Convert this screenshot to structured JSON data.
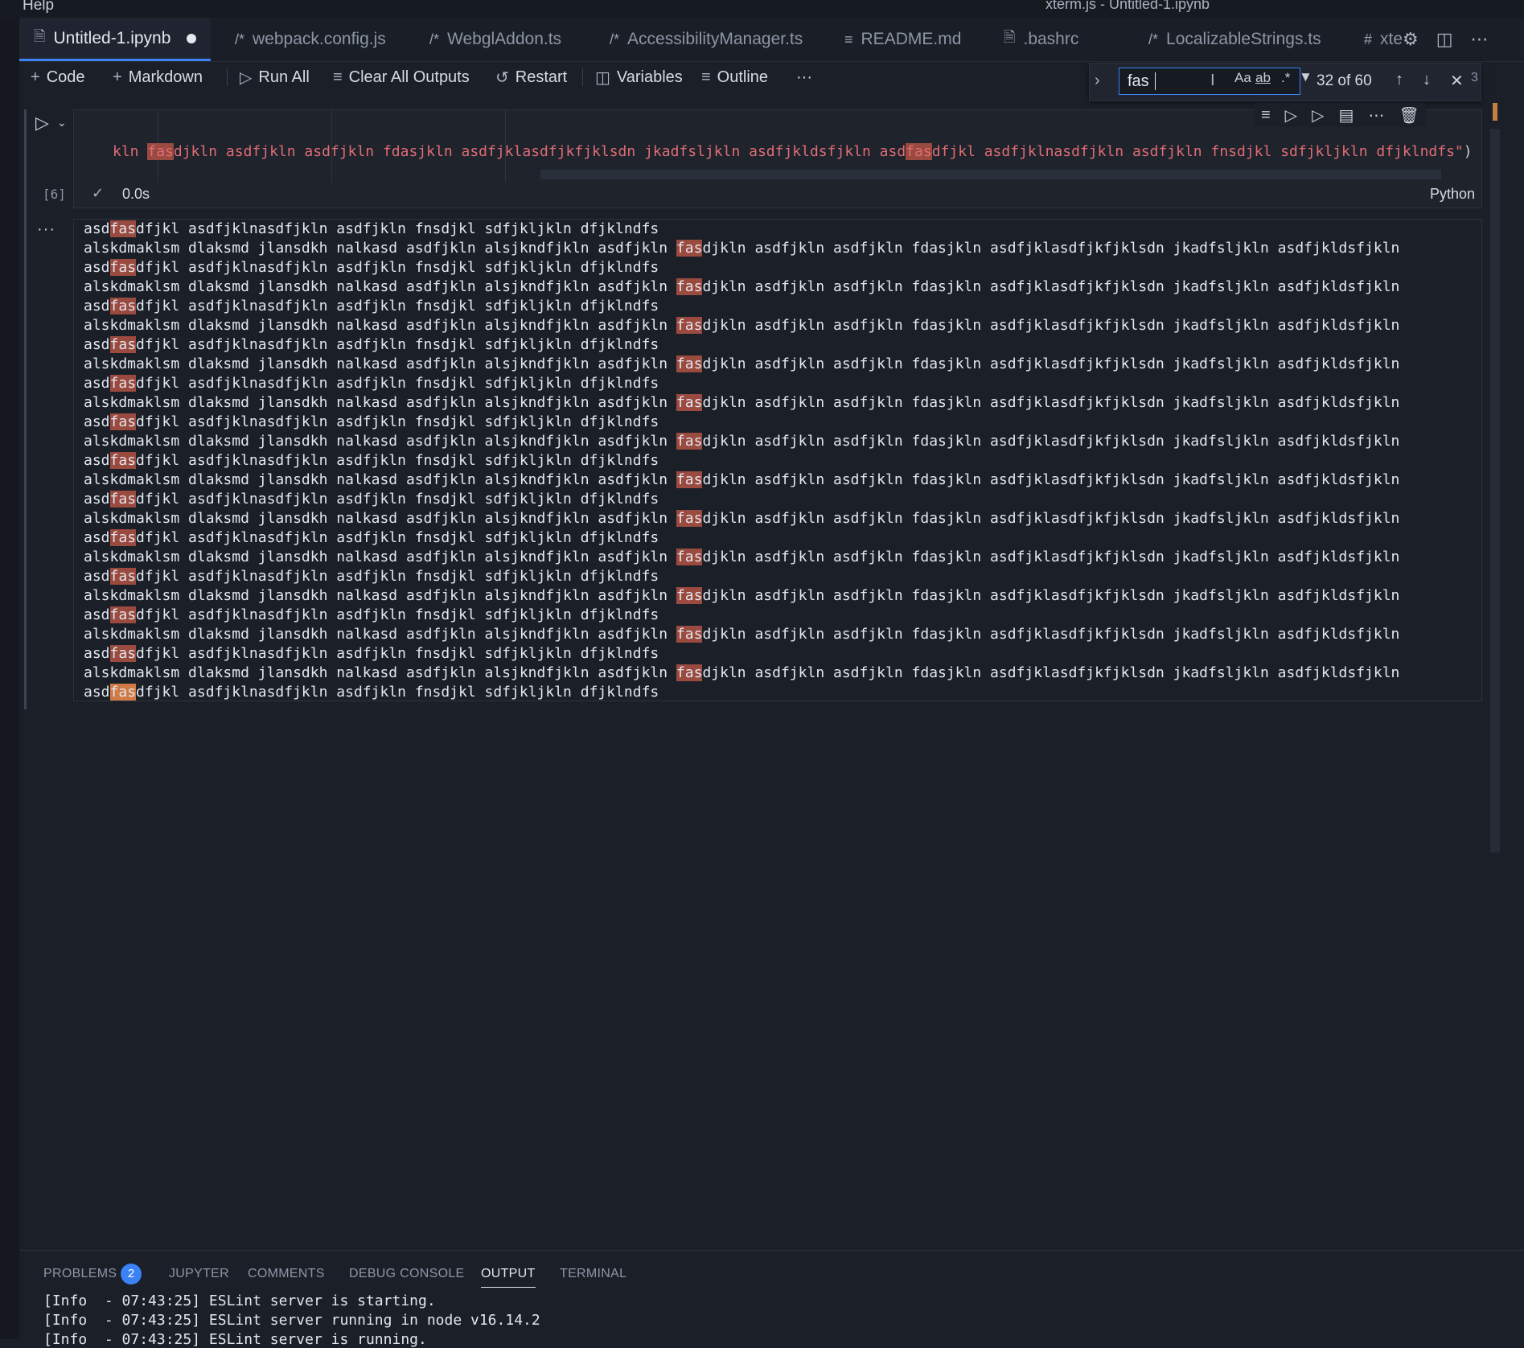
{
  "titlebar": {
    "menu_help": "Help",
    "window_title": "xterm.js - Untitled-1.ipynb"
  },
  "tabs": [
    {
      "label": "Untitled-1.ipynb",
      "icon": "notebook-icon",
      "active": true,
      "modified": true
    },
    {
      "label": "webpack.config.js",
      "icon": "js-icon"
    },
    {
      "label": "WebglAddon.ts",
      "icon": "ts-icon"
    },
    {
      "label": "AccessibilityManager.ts",
      "icon": "ts-icon"
    },
    {
      "label": "README.md",
      "icon": "markdown-icon"
    },
    {
      "label": ".bashrc",
      "icon": "file-icon"
    },
    {
      "label": "LocalizableStrings.ts",
      "icon": "ts-icon"
    },
    {
      "label": "xte",
      "icon": "hash-icon"
    }
  ],
  "toolbar": {
    "code": "Code",
    "markdown": "Markdown",
    "run_all": "Run All",
    "clear_outputs": "Clear All Outputs",
    "restart": "Restart",
    "variables": "Variables",
    "outline": "Outline",
    "more": "···"
  },
  "find": {
    "value": "fas",
    "match_case": "Aa",
    "whole_word": "ab",
    "regex": ".*",
    "count": "32 of 60",
    "overflow_digit": "3"
  },
  "cell": {
    "execution_count": "[6]",
    "time": "0.0s",
    "language": "Python",
    "code_segments": [
      {
        "t": "kln ",
        "h": false
      },
      {
        "t": "fas",
        "h": true
      },
      {
        "t": "djkln asdfjkln asdfjkln fdasjkln asdfjklasdfjkfjklsdn jkadfsljkln asdfjkldsfjkln asd",
        "h": false
      },
      {
        "t": "fas",
        "h": true
      },
      {
        "t": "dfjkl asdfjklnasdfjkln asdfjkln fnsdjkl sdfjkljkln dfjklndfs\"",
        "h": false
      }
    ],
    "code_end": ")"
  },
  "output": {
    "more": "···",
    "lines": [
      {
        "a": "asd",
        "b": "fas",
        "c": "dfjkl asdfjklnasdfjkln asdfjkln fnsdjkl sdfjkljkln dfjklndfs"
      },
      {
        "a": "alskdmaklsm dlaksmd jlansdkh nalkasd asdfjkln alsjkndfjkln asdfjkln ",
        "b": "fas",
        "c": "djkln asdfjkln asdfjkln fdasjkln asdfjklasdfjkfjklsdn jkadfsljkln asdfjkldsfjkln"
      },
      {
        "a": "asd",
        "b": "fas",
        "c": "dfjkl asdfjklnasdfjkln asdfjkln fnsdjkl sdfjkljkln dfjklndfs"
      },
      {
        "a": "alskdmaklsm dlaksmd jlansdkh nalkasd asdfjkln alsjkndfjkln asdfjkln ",
        "b": "fas",
        "c": "djkln asdfjkln asdfjkln fdasjkln asdfjklasdfjkfjklsdn jkadfsljkln asdfjkldsfjkln"
      },
      {
        "a": "asd",
        "b": "fas",
        "c": "dfjkl asdfjklnasdfjkln asdfjkln fnsdjkl sdfjkljkln dfjklndfs"
      },
      {
        "a": "alskdmaklsm dlaksmd jlansdkh nalkasd asdfjkln alsjkndfjkln asdfjkln ",
        "b": "fas",
        "c": "djkln asdfjkln asdfjkln fdasjkln asdfjklasdfjkfjklsdn jkadfsljkln asdfjkldsfjkln"
      },
      {
        "a": "asd",
        "b": "fas",
        "c": "dfjkl asdfjklnasdfjkln asdfjkln fnsdjkl sdfjkljkln dfjklndfs"
      },
      {
        "a": "alskdmaklsm dlaksmd jlansdkh nalkasd asdfjkln alsjkndfjkln asdfjkln ",
        "b": "fas",
        "c": "djkln asdfjkln asdfjkln fdasjkln asdfjklasdfjkfjklsdn jkadfsljkln asdfjkldsfjkln"
      },
      {
        "a": "asd",
        "b": "fas",
        "c": "dfjkl asdfjklnasdfjkln asdfjkln fnsdjkl sdfjkljkln dfjklndfs"
      },
      {
        "a": "alskdmaklsm dlaksmd jlansdkh nalkasd asdfjkln alsjkndfjkln asdfjkln ",
        "b": "fas",
        "c": "djkln asdfjkln asdfjkln fdasjkln asdfjklasdfjkfjklsdn jkadfsljkln asdfjkldsfjkln"
      },
      {
        "a": "asd",
        "b": "fas",
        "c": "dfjkl asdfjklnasdfjkln asdfjkln fnsdjkl sdfjkljkln dfjklndfs"
      },
      {
        "a": "alskdmaklsm dlaksmd jlansdkh nalkasd asdfjkln alsjkndfjkln asdfjkln ",
        "b": "fas",
        "c": "djkln asdfjkln asdfjkln fdasjkln asdfjklasdfjkfjklsdn jkadfsljkln asdfjkldsfjkln"
      },
      {
        "a": "asd",
        "b": "fas",
        "c": "dfjkl asdfjklnasdfjkln asdfjkln fnsdjkl sdfjkljkln dfjklndfs"
      },
      {
        "a": "alskdmaklsm dlaksmd jlansdkh nalkasd asdfjkln alsjkndfjkln asdfjkln ",
        "b": "fas",
        "c": "djkln asdfjkln asdfjkln fdasjkln asdfjklasdfjkfjklsdn jkadfsljkln asdfjkldsfjkln"
      },
      {
        "a": "asd",
        "b": "fas",
        "c": "dfjkl asdfjklnasdfjkln asdfjkln fnsdjkl sdfjkljkln dfjklndfs"
      },
      {
        "a": "alskdmaklsm dlaksmd jlansdkh nalkasd asdfjkln alsjkndfjkln asdfjkln ",
        "b": "fas",
        "c": "djkln asdfjkln asdfjkln fdasjkln asdfjklasdfjkfjklsdn jkadfsljkln asdfjkldsfjkln"
      },
      {
        "a": "asd",
        "b": "fas",
        "c": "dfjkl asdfjklnasdfjkln asdfjkln fnsdjkl sdfjkljkln dfjklndfs"
      },
      {
        "a": "alskdmaklsm dlaksmd jlansdkh nalkasd asdfjkln alsjkndfjkln asdfjkln ",
        "b": "fas",
        "c": "djkln asdfjkln asdfjkln fdasjkln asdfjklasdfjkfjklsdn jkadfsljkln asdfjkldsfjkln"
      },
      {
        "a": "asd",
        "b": "fas",
        "c": "dfjkl asdfjklnasdfjkln asdfjkln fnsdjkl sdfjkljkln dfjklndfs"
      },
      {
        "a": "alskdmaklsm dlaksmd jlansdkh nalkasd asdfjkln alsjkndfjkln asdfjkln ",
        "b": "fas",
        "c": "djkln asdfjkln asdfjkln fdasjkln asdfjklasdfjkfjklsdn jkadfsljkln asdfjkldsfjkln"
      },
      {
        "a": "asd",
        "b": "fas",
        "c": "dfjkl asdfjklnasdfjkln asdfjkln fnsdjkl sdfjkljkln dfjklndfs"
      },
      {
        "a": "alskdmaklsm dlaksmd jlansdkh nalkasd asdfjkln alsjkndfjkln asdfjkln ",
        "b": "fas",
        "c": "djkln asdfjkln asdfjkln fdasjkln asdfjklasdfjkfjklsdn jkadfsljkln asdfjkldsfjkln"
      },
      {
        "a": "asd",
        "b": "fas",
        "c": "dfjkl asdfjklnasdfjkln asdfjkln fnsdjkl sdfjkljkln dfjklndfs"
      },
      {
        "a": "alskdmaklsm dlaksmd jlansdkh nalkasd asdfjkln alsjkndfjkln asdfjkln ",
        "b": "fas",
        "c": "djkln asdfjkln asdfjkln fdasjkln asdfjklasdfjkfjklsdn jkadfsljkln asdfjkldsfjkln"
      },
      {
        "a": "asd",
        "b": "fas",
        "c": "dfjkl asdfjklnasdfjkln asdfjkln fnsdjkl sdfjkljkln dfjklndfs",
        "current": true
      }
    ]
  },
  "panel": {
    "tabs": [
      "PROBLEMS",
      "JUPYTER",
      "COMMENTS",
      "DEBUG CONSOLE",
      "OUTPUT",
      "TERMINAL"
    ],
    "problems_count": "2",
    "active_tab": "OUTPUT",
    "lines": [
      "[Info  - 07:43:25] ESLint server is starting.",
      "[Info  - 07:43:25] ESLint server running in node v16.14.2",
      "[Info  - 07:43:25] ESLint server is running."
    ]
  },
  "colors": {
    "accent": "#3b82f6",
    "match_highlight": "#9a4a3f",
    "current_match": "#d07a45",
    "string": "#e06c75"
  }
}
